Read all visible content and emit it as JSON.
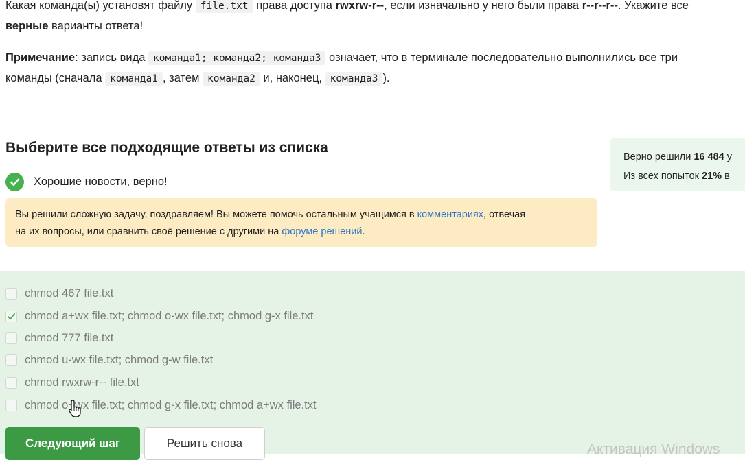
{
  "question": {
    "p1_a": "Какая команда(ы) установят файлу ",
    "p1_code": "file.txt",
    "p1_b": " права доступа ",
    "p1_target": "rwxrw-r--",
    "p1_c": ", если изначально у него были права ",
    "p1_initial": "r--r--r--",
    "p1_d": ". Укажите все",
    "p1_bold2": "верные",
    "p1_e": " варианты ответа!",
    "note_label": "Примечание",
    "note_a": ": запись вида ",
    "note_code1": "команда1; команда2; команда3",
    "note_b": " означает, что в терминале последовательно выполнились все три",
    "note_c": "команды (сначала ",
    "note_code2": "команда1",
    "note_d": ", затем ",
    "note_code3": "команда2",
    "note_e": " и, наконец, ",
    "note_code4": "команда3",
    "note_f": ")."
  },
  "section_title": "Выберите все подходящие ответы из списка",
  "verdict": {
    "icon": "check-circle-icon",
    "text": "Хорошие новости, верно!",
    "color": "#47b14f"
  },
  "congrats": {
    "text_a": "Вы решили сложную задачу, поздравляем! Вы можете помочь остальным учащимся в ",
    "link1": "комментариях",
    "text_b": ", отвечая",
    "text_c": "на их вопросы, или сравнить своё решение с другими на ",
    "link2": "форуме решений",
    "text_d": "."
  },
  "stats": {
    "line1_a": "Верно решили ",
    "line1_num": "16 484",
    "line1_b": " у",
    "line2_a": "Из всех попыток ",
    "line2_num": "21%",
    "line2_b": " в"
  },
  "options": [
    {
      "label": "chmod 467 file.txt",
      "checked": false
    },
    {
      "label": "chmod a+wx file.txt; chmod o-wx file.txt; chmod g-x file.txt",
      "checked": true
    },
    {
      "label": "chmod 777 file.txt",
      "checked": false
    },
    {
      "label": "chmod u-wx file.txt; chmod g-w file.txt",
      "checked": false
    },
    {
      "label": "chmod rwxrw-r-- file.txt",
      "checked": false
    },
    {
      "label": "chmod o+wx file.txt; chmod g-x file.txt; chmod a+wx file.txt",
      "checked": false
    }
  ],
  "buttons": {
    "next": "Следующий шаг",
    "retry": "Решить снова"
  },
  "watermark": "Активация Windows",
  "colors": {
    "primary": "#3c9a45",
    "answers_bg": "#e5f2e6",
    "congrats_bg": "#fdebc3",
    "link": "#2e78c7",
    "stats_bg": "#ebf6ec"
  }
}
